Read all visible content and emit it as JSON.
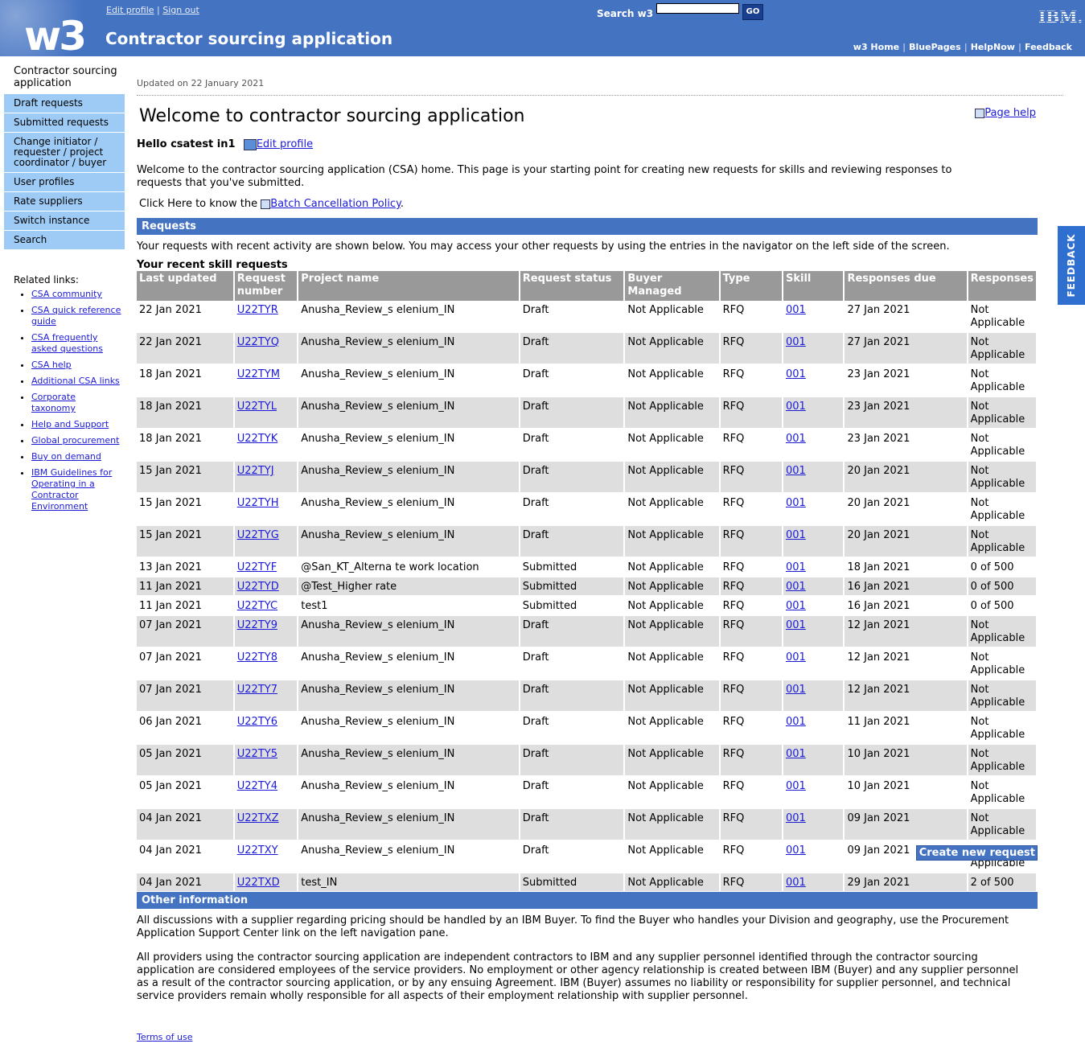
{
  "header": {
    "logo": "w3",
    "edit_profile": "Edit profile",
    "sign_out": "Sign out",
    "separator": "|",
    "app_title": "Contractor sourcing application",
    "search_label": "Search w3",
    "search_value": "",
    "go_label": "GO",
    "ibm_logo": "IBM.",
    "util_nav": [
      "w3 Home",
      "BluePages",
      "HelpNow",
      "Feedback"
    ]
  },
  "left_nav": {
    "title": "Contractor sourcing application",
    "items": [
      "Draft requests",
      "Submitted requests",
      "Change initiator / requester / project coordinator / buyer",
      "User profiles",
      "Rate suppliers",
      "Switch instance",
      "Search"
    ],
    "related_header": "Related links:",
    "related": [
      "CSA community",
      "CSA quick reference guide",
      "CSA frequently asked questions",
      "CSA help",
      "Additional CSA links",
      "Corporate taxonomy",
      "Help and Support",
      "Global procurement",
      "Buy on demand",
      "IBM Guidelines for Operating in a Contractor Environment"
    ]
  },
  "content": {
    "updated": "Updated on 22 January 2021",
    "title": "Welcome to contractor sourcing application",
    "page_help": "Page help",
    "hello": "Hello csatest in1",
    "edit_profile": "Edit profile",
    "welcome": "Welcome to the contractor sourcing application (CSA) home. This page is your starting point for creating new requests for skills and reviewing responses to requests that you've submitted.",
    "policy_prefix": "Click Here to know the ",
    "policy_link": "Batch Cancellation Policy",
    "policy_suffix": ".",
    "requests_header": "Requests",
    "requests_intro": "Your requests with recent activity are shown below. You may access your other requests by using the entries in the navigator on the left side of the screen.",
    "table_title": "Your recent skill requests",
    "columns": [
      "Last updated",
      "Request number",
      "Project name",
      "Request status",
      "Buyer Managed",
      "Type",
      "Skill",
      "Responses due",
      "Responses"
    ],
    "rows": [
      [
        "22 Jan 2021",
        "U22TYR",
        "Anusha_Review_s elenium_IN",
        "Draft",
        "Not Applicable",
        "RFQ",
        "001",
        "27 Jan 2021",
        "Not Applicable"
      ],
      [
        "22 Jan 2021",
        "U22TYQ",
        "Anusha_Review_s elenium_IN",
        "Draft",
        "Not Applicable",
        "RFQ",
        "001",
        "27 Jan 2021",
        "Not Applicable"
      ],
      [
        "18 Jan 2021",
        "U22TYM",
        "Anusha_Review_s elenium_IN",
        "Draft",
        "Not Applicable",
        "RFQ",
        "001",
        "23 Jan 2021",
        "Not Applicable"
      ],
      [
        "18 Jan 2021",
        "U22TYL",
        "Anusha_Review_s elenium_IN",
        "Draft",
        "Not Applicable",
        "RFQ",
        "001",
        "23 Jan 2021",
        "Not Applicable"
      ],
      [
        "18 Jan 2021",
        "U22TYK",
        "Anusha_Review_s elenium_IN",
        "Draft",
        "Not Applicable",
        "RFQ",
        "001",
        "23 Jan 2021",
        "Not Applicable"
      ],
      [
        "15 Jan 2021",
        "U22TYJ",
        "Anusha_Review_s elenium_IN",
        "Draft",
        "Not Applicable",
        "RFQ",
        "001",
        "20 Jan 2021",
        "Not Applicable"
      ],
      [
        "15 Jan 2021",
        "U22TYH",
        "Anusha_Review_s elenium_IN",
        "Draft",
        "Not Applicable",
        "RFQ",
        "001",
        "20 Jan 2021",
        "Not Applicable"
      ],
      [
        "15 Jan 2021",
        "U22TYG",
        "Anusha_Review_s elenium_IN",
        "Draft",
        "Not Applicable",
        "RFQ",
        "001",
        "20 Jan 2021",
        "Not Applicable"
      ],
      [
        "13 Jan 2021",
        "U22TYF",
        "@San_KT_Alterna te work location",
        "Submitted",
        "Not Applicable",
        "RFQ",
        "001",
        "18 Jan 2021",
        "0 of 500"
      ],
      [
        "11 Jan 2021",
        "U22TYD",
        "@Test_Higher rate",
        "Submitted",
        "Not Applicable",
        "RFQ",
        "001",
        "16 Jan 2021",
        "0 of 500"
      ],
      [
        "11 Jan 2021",
        "U22TYC",
        "test1",
        "Submitted",
        "Not Applicable",
        "RFQ",
        "001",
        "16 Jan 2021",
        "0 of 500"
      ],
      [
        "07 Jan 2021",
        "U22TY9",
        "Anusha_Review_s elenium_IN",
        "Draft",
        "Not Applicable",
        "RFQ",
        "001",
        "12 Jan 2021",
        "Not Applicable"
      ],
      [
        "07 Jan 2021",
        "U22TY8",
        "Anusha_Review_s elenium_IN",
        "Draft",
        "Not Applicable",
        "RFQ",
        "001",
        "12 Jan 2021",
        "Not Applicable"
      ],
      [
        "07 Jan 2021",
        "U22TY7",
        "Anusha_Review_s elenium_IN",
        "Draft",
        "Not Applicable",
        "RFQ",
        "001",
        "12 Jan 2021",
        "Not Applicable"
      ],
      [
        "06 Jan 2021",
        "U22TY6",
        "Anusha_Review_s elenium_IN",
        "Draft",
        "Not Applicable",
        "RFQ",
        "001",
        "11 Jan 2021",
        "Not Applicable"
      ],
      [
        "05 Jan 2021",
        "U22TY5",
        "Anusha_Review_s elenium_IN",
        "Draft",
        "Not Applicable",
        "RFQ",
        "001",
        "10 Jan 2021",
        "Not Applicable"
      ],
      [
        "05 Jan 2021",
        "U22TY4",
        "Anusha_Review_s elenium_IN",
        "Draft",
        "Not Applicable",
        "RFQ",
        "001",
        "10 Jan 2021",
        "Not Applicable"
      ],
      [
        "04 Jan 2021",
        "U22TXZ",
        "Anusha_Review_s elenium_IN",
        "Draft",
        "Not Applicable",
        "RFQ",
        "001",
        "09 Jan 2021",
        "Not Applicable"
      ],
      [
        "04 Jan 2021",
        "U22TXY",
        "Anusha_Review_s elenium_IN",
        "Draft",
        "Not Applicable",
        "RFQ",
        "001",
        "09 Jan 2021",
        "Not Applicable"
      ],
      [
        "04 Jan 2021",
        "U22TXD",
        "test_IN",
        "Submitted",
        "Not Applicable",
        "RFQ",
        "001",
        "29 Jan 2021",
        "2 of 500"
      ]
    ],
    "create_button": "Create new request",
    "other_header": "Other information",
    "other_p1": "All discussions with a supplier regarding pricing should be handled by an IBM Buyer. To find the Buyer who handles your Division and geography, use the Procurement Application Support Center link on the left navigation pane.",
    "other_p2": "All providers using the contractor sourcing application are independent contractors to IBM and any supplier personnel identified through the contractor sourcing application are considered employees of the service providers. No employment or other agency relationship is created between IBM (Buyer) and any supplier personnel as a result of the contractor sourcing application, or by any ensuing Agreement. IBM (Buyer) assumes no liability or responsibility for supplier personnel, and technical service providers remain wholly responsible for all aspects of their employment relationship with supplier personnel.",
    "terms": "Terms of use"
  },
  "feedback_tab": "FEEDBACK",
  "colors": {
    "header_blue": "#4473c2",
    "nav_blue": "#9dcbf6",
    "table_header": "#999999",
    "row_alt": "#dedede",
    "feedback": "#2e6fd0"
  }
}
